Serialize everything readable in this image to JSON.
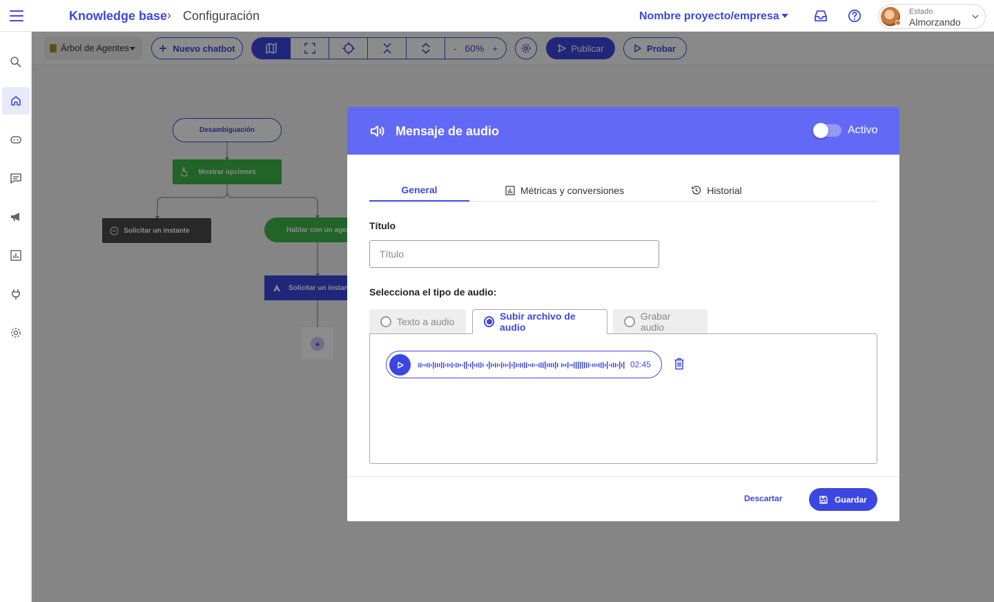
{
  "header": {
    "breadcrumb_root": "Knowledge base",
    "breadcrumb_separator": "›",
    "breadcrumb_current": "Configuración",
    "project_selector": "Nombre proyecto/empresa",
    "status_label": "Estado",
    "status_value": "Almorzando",
    "icons": [
      "menu-icon",
      "inbox-icon",
      "help-icon",
      "avatar",
      "chevron-down-icon"
    ]
  },
  "sidebar": {
    "items": [
      {
        "icon": "search-icon",
        "active": false
      },
      {
        "icon": "home-icon",
        "active": true
      },
      {
        "icon": "bot-icon",
        "active": false
      },
      {
        "icon": "chat-icon",
        "active": false
      },
      {
        "icon": "megaphone-icon",
        "active": false
      },
      {
        "icon": "chart-icon",
        "active": false
      },
      {
        "icon": "plug-icon",
        "active": false
      },
      {
        "icon": "settings-icon",
        "active": false
      }
    ]
  },
  "toolbar": {
    "tree_select": "Árbol de Agentes",
    "new_chatbot": "Nuevo chatbot",
    "zoom_minus": "-",
    "zoom_value": "60%",
    "zoom_plus": "+",
    "publish": "Publicar",
    "test": "Probar"
  },
  "flow": {
    "nodes": [
      "Desambiguación",
      "Mostrar opciones",
      "Solicitar un instante",
      "Hablar con un agente",
      "Solicitar un instante"
    ],
    "add_symbol": "+"
  },
  "modal": {
    "title": "Mensaje de audio",
    "toggle_label": "Activo",
    "toggle_on": false,
    "tabs": [
      {
        "label": "General",
        "icon": "",
        "active": true
      },
      {
        "label": "Métricas y conversiones",
        "icon": "bar-chart-icon",
        "active": false
      },
      {
        "label": "Historial",
        "icon": "history-icon",
        "active": false
      }
    ],
    "title_label": "Título",
    "title_placeholder": "Título",
    "title_value": "",
    "audio_type_label": "Selecciona el tipo de audio:",
    "audio_types": [
      {
        "label": "Texto a audio",
        "selected": false
      },
      {
        "label": "Subir archivo de audio",
        "selected": true
      },
      {
        "label": "Grabar audio",
        "selected": false
      }
    ],
    "audio_duration": "02:45",
    "discard": "Descartar",
    "save": "Guardar"
  },
  "colors": {
    "accent": "#3b47e0",
    "modal_header": "#6369f7",
    "node_green": "#3fb44a",
    "node_dark": "#4a4a4a",
    "status_dot": "#f26a21"
  }
}
